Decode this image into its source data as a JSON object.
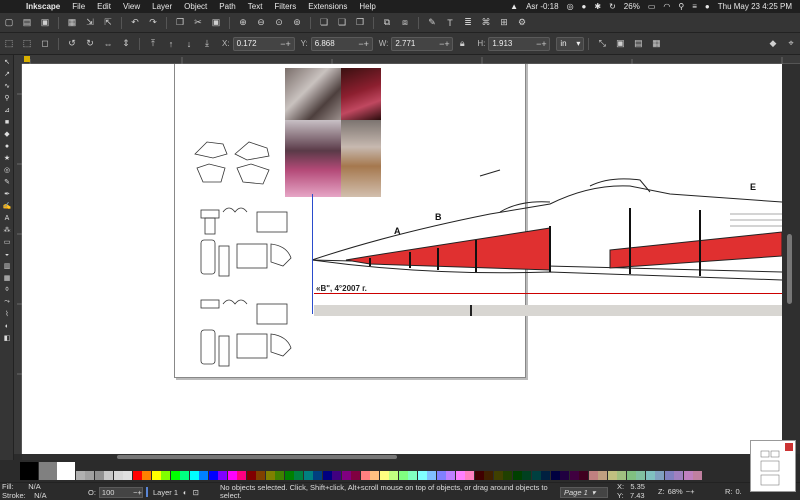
{
  "menubar": {
    "app_name": "Inkscape",
    "menus": [
      "File",
      "Edit",
      "View",
      "Layer",
      "Object",
      "Path",
      "Text",
      "Filters",
      "Extensions",
      "Help"
    ],
    "status_icons_text": "Asr -0:18",
    "battery": "26%",
    "clock": "Thu May 23  4:25 PM"
  },
  "toolbar": {
    "x_label": "X:",
    "x_value": "0.172",
    "y_label": "Y:",
    "y_value": "6.868",
    "w_label": "W:",
    "w_value": "2.771",
    "h_label": "H:",
    "h_value": "1.913",
    "units": "in"
  },
  "canvas": {
    "drawing_caption": "«B\",  4°2007 г.",
    "label_a": "A",
    "label_b": "B",
    "label_e": "E"
  },
  "palette": {
    "colors": [
      "#000000",
      "#808080",
      "#ffffff",
      "#b0b0b0",
      "#a0a0a0",
      "#909090",
      "#c8c8c8",
      "#d8d8d8",
      "#e0e0e0",
      "#ff0000",
      "#ff8000",
      "#ffff00",
      "#80ff00",
      "#00ff00",
      "#00ff80",
      "#00ffff",
      "#0080ff",
      "#0000ff",
      "#8000ff",
      "#ff00ff",
      "#ff0080",
      "#800000",
      "#804000",
      "#808000",
      "#408000",
      "#008000",
      "#008040",
      "#008080",
      "#004080",
      "#000080",
      "#400080",
      "#800080",
      "#800040",
      "#ff8080",
      "#ffc080",
      "#ffff80",
      "#c0ff80",
      "#80ff80",
      "#80ffc0",
      "#80ffff",
      "#80c0ff",
      "#8080ff",
      "#c080ff",
      "#ff80ff",
      "#ff80c0",
      "#400000",
      "#402000",
      "#404000",
      "#204000",
      "#004000",
      "#004020",
      "#004040",
      "#002040",
      "#000040",
      "#200040",
      "#400040",
      "#400020",
      "#c08080",
      "#c0a080",
      "#c0c080",
      "#a0c080",
      "#80c080",
      "#80c0a0",
      "#80c0c0",
      "#80a0c0",
      "#8080c0",
      "#a080c0",
      "#c080c0",
      "#c080a0"
    ]
  },
  "status": {
    "fill_label": "Fill:",
    "fill_value": "N/A",
    "stroke_label": "Stroke:",
    "stroke_value": "N/A",
    "opacity_label": "O:",
    "opacity_value": "100",
    "layer_name": "Layer 1",
    "message": "No objects selected. Click, Shift+click, Alt+scroll mouse on top of objects, or drag around objects to select.",
    "page": "Page 1",
    "cursor_x_label": "X:",
    "cursor_x": "5.35",
    "cursor_y_label": "Y:",
    "cursor_y": "7.43",
    "zoom_label": "Z:",
    "zoom_value": "68%",
    "rotation_label": "R:",
    "rotation_value": "0."
  }
}
